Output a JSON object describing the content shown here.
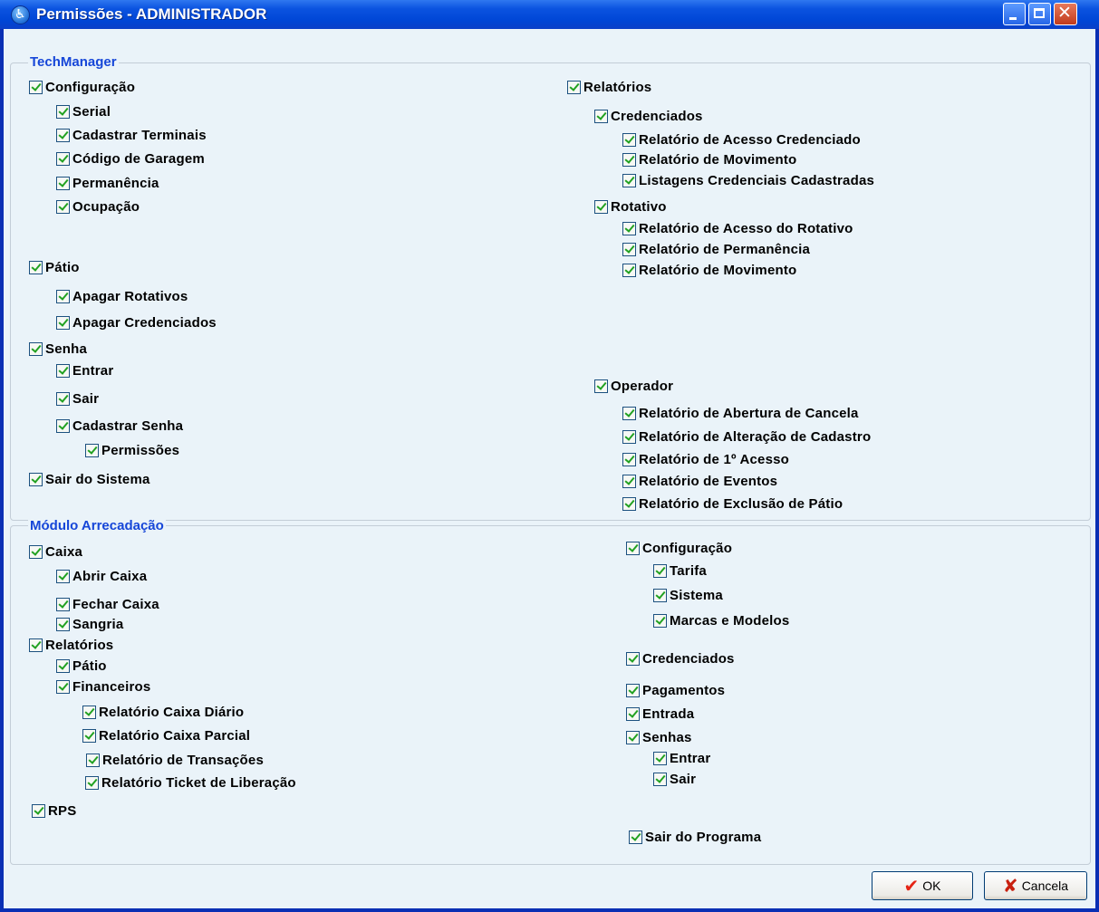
{
  "window": {
    "title": "Permissões - ADMINISTRADOR"
  },
  "groups": {
    "techmanager": "TechManager",
    "arrecadacao": "Módulo Arrecadação"
  },
  "tech": {
    "configuracao": {
      "label": "Configuração",
      "items": [
        "Serial",
        "Cadastrar Terminais",
        "Código de Garagem",
        "Permanência",
        "Ocupação"
      ]
    },
    "patio": {
      "label": "Pátio",
      "items": [
        "Apagar Rotativos",
        "Apagar Credenciados"
      ]
    },
    "senha": {
      "label": "Senha",
      "items": [
        "Entrar",
        "Sair",
        "Cadastrar Senha"
      ],
      "sub": "Permissões"
    },
    "sair_sistema": "Sair do Sistema",
    "relatorios": {
      "label": "Relatórios",
      "credenciados": {
        "label": "Credenciados",
        "items": [
          "Relatório de Acesso Credenciado",
          "Relatório de Movimento",
          "Listagens Credenciais Cadastradas"
        ]
      },
      "rotativo": {
        "label": "Rotativo",
        "items": [
          "Relatório de Acesso do Rotativo",
          "Relatório de Permanência",
          "Relatório de Movimento"
        ]
      }
    },
    "operador": {
      "label": "Operador",
      "items": [
        "Relatório de Abertura de Cancela",
        "Relatório de Alteração de Cadastro",
        "Relatório de 1º Acesso",
        "Relatório de Eventos",
        "Relatório de Exclusão de Pátio"
      ]
    }
  },
  "arr": {
    "caixa": {
      "label": "Caixa",
      "items": [
        "Abrir Caixa",
        "Fechar Caixa",
        "Sangria"
      ]
    },
    "relatorios": {
      "label": "Relatórios",
      "patio": "Pátio",
      "financeiros": "Financeiros",
      "fin_items": [
        "Relatório Caixa Diário",
        "Relatório Caixa Parcial",
        "Relatório de Transações",
        "Relatório Ticket de Liberação"
      ]
    },
    "rps": "RPS",
    "configuracao": {
      "label": "Configuração",
      "items": [
        "Tarifa",
        "Sistema",
        "Marcas e Modelos"
      ]
    },
    "credenciados": "Credenciados",
    "pagamentos": "Pagamentos",
    "entrada": "Entrada",
    "senhas": {
      "label": "Senhas",
      "items": [
        "Entrar",
        "Sair"
      ]
    },
    "sair_programa": "Sair do Programa"
  },
  "buttons": {
    "ok": "OK",
    "cancel": "Cancela"
  }
}
